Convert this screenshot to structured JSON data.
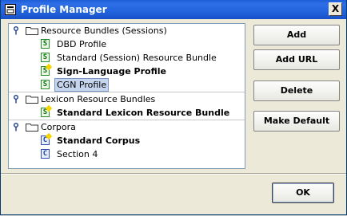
{
  "window": {
    "title": "Profile Manager",
    "close_label": "X"
  },
  "tree": {
    "groups": [
      {
        "label": "Resource Bundles (Sessions)",
        "items": [
          {
            "label": "DBD Profile",
            "icon": "session-bundle-icon"
          },
          {
            "label": "Standard (Session) Resource Bundle",
            "icon": "session-bundle-icon"
          },
          {
            "label": "Sign-Language Profile",
            "icon": "session-bundle-default-icon"
          },
          {
            "label": "CGN Profile",
            "icon": "session-bundle-icon"
          }
        ]
      },
      {
        "label": "Lexicon Resource Bundles",
        "items": [
          {
            "label": "Standard Lexicon Resource Bundle",
            "icon": "session-bundle-default-icon"
          }
        ]
      },
      {
        "label": "Corpora",
        "items": [
          {
            "label": "Standard Corpus",
            "icon": "corpus-default-icon"
          },
          {
            "label": "Section 4",
            "icon": "corpus-icon"
          }
        ]
      }
    ]
  },
  "buttons": {
    "add": "Add",
    "add_url": "Add URL",
    "delete": "Delete",
    "make_default": "Make Default",
    "ok": "OK"
  },
  "colors": {
    "titlebar": "#2264dd",
    "selection": "#c6d5ee",
    "bundle_icon": "#2a8a2a",
    "corpus_icon": "#2c4fb0",
    "default_marker": "#f5d400"
  }
}
